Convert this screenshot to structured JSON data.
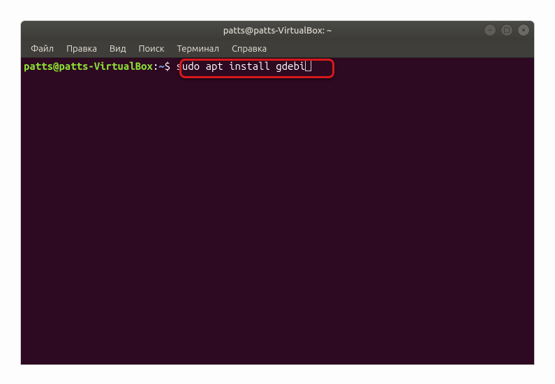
{
  "window": {
    "title": "patts@patts-VirtualBox: ~",
    "controls": {
      "minimize_icon": "–",
      "maximize_icon": "□",
      "close_icon": "×"
    }
  },
  "menubar": {
    "items": [
      {
        "label": "Файл"
      },
      {
        "label": "Правка"
      },
      {
        "label": "Вид"
      },
      {
        "label": "Поиск"
      },
      {
        "label": "Терминал"
      },
      {
        "label": "Справка"
      }
    ]
  },
  "terminal": {
    "prompt": {
      "user_host": "patts@patts-VirtualBox",
      "separator": ":",
      "path": "~",
      "symbol": "$"
    },
    "command": "sudo apt install gdebi"
  }
}
